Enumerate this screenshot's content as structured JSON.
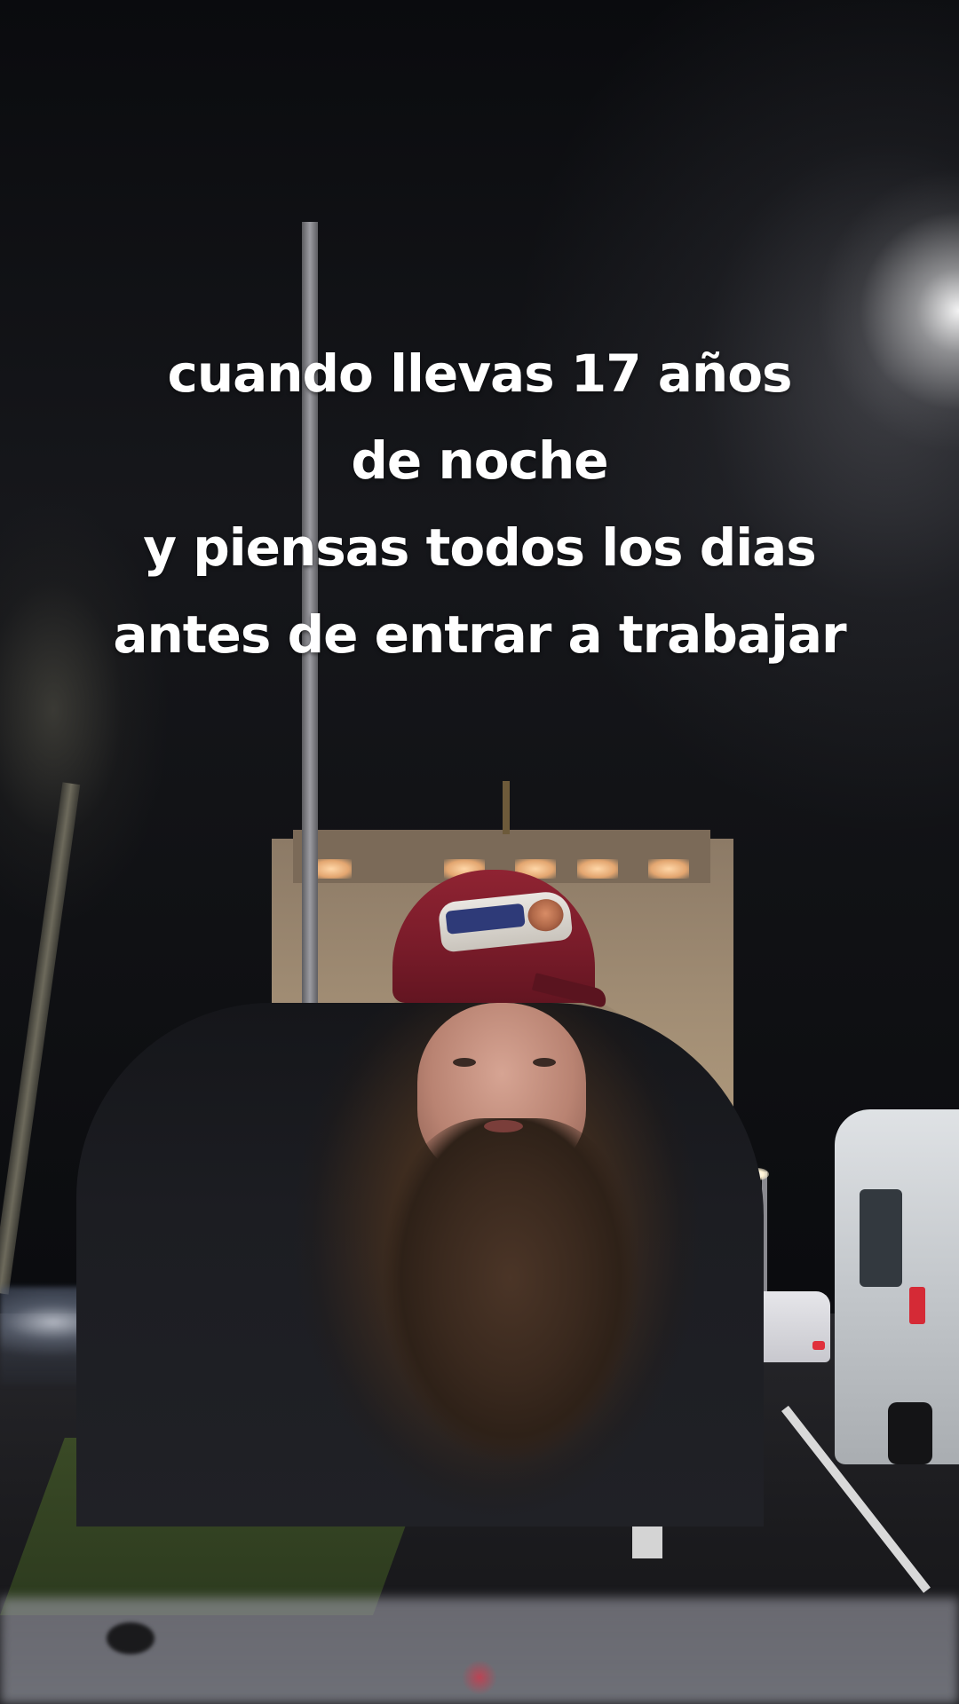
{
  "caption": {
    "lines": [
      "cuando llevas 17 años",
      "de noche",
      "y piensas todos los dias",
      "antes de entrar a trabajar"
    ]
  },
  "scene": {
    "description_icons": [
      "arch-monument",
      "street-lamp-pole",
      "person-with-cap-and-beard",
      "white-van",
      "white-car",
      "bare-tree"
    ],
    "colors": {
      "sky": "#0a0b0e",
      "cap": "#7a1c2a",
      "arch": "#a18d74",
      "caption_text": "#ffffff"
    }
  }
}
